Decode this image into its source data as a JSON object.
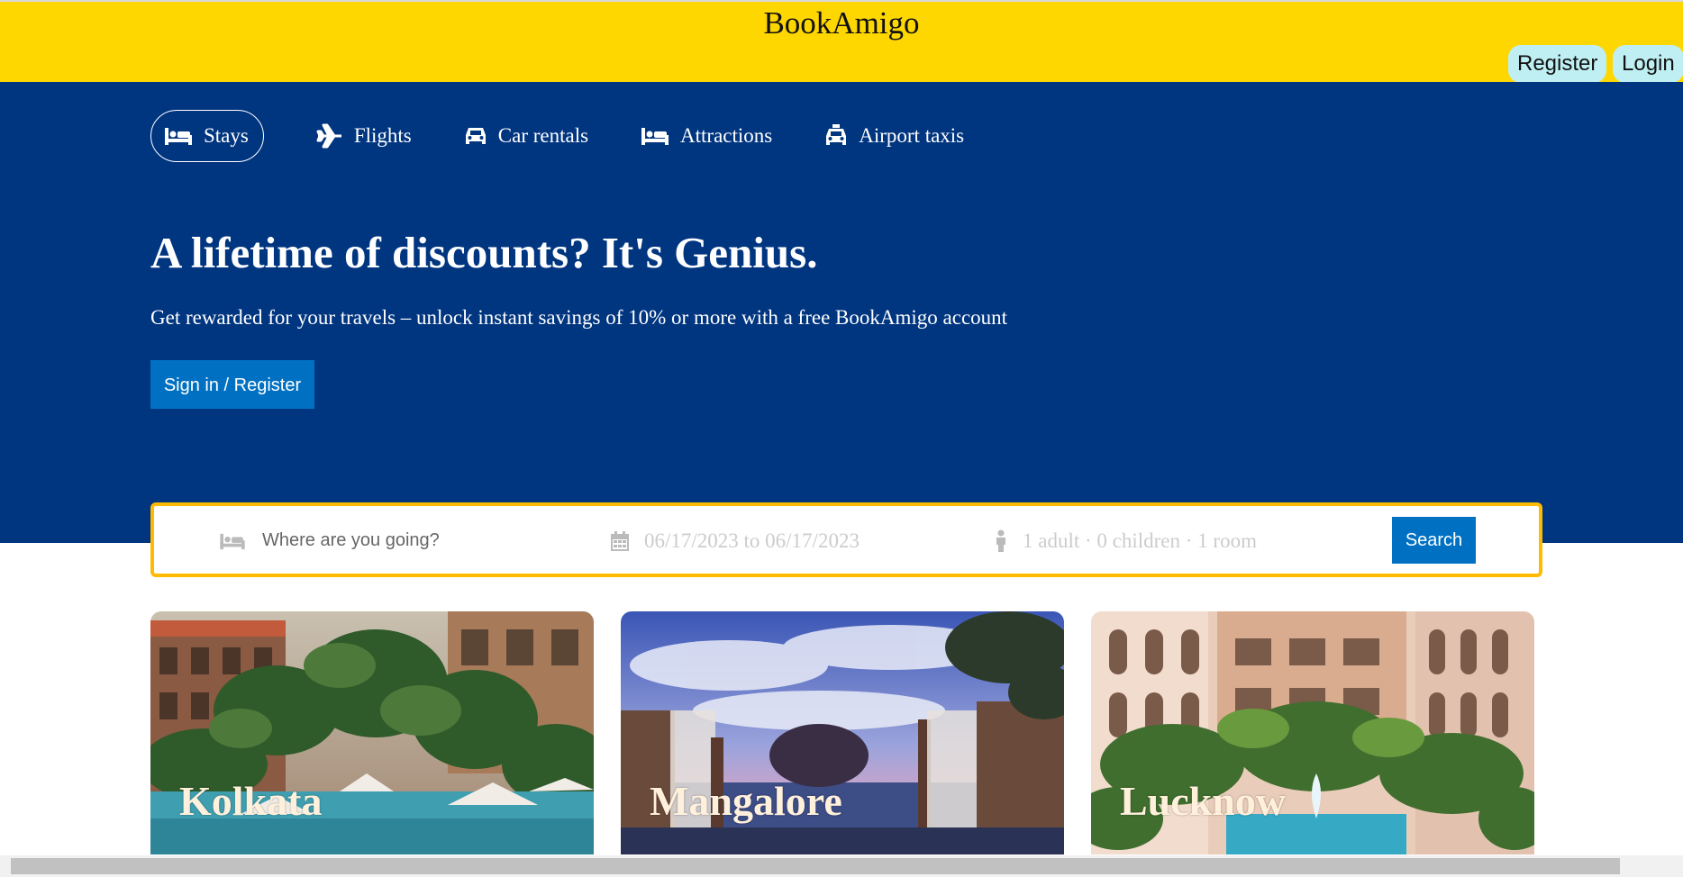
{
  "header": {
    "brand": "BookAmigo",
    "register_label": "Register",
    "login_label": "Login"
  },
  "nav": {
    "items": [
      {
        "label": "Stays",
        "icon": "bed-icon",
        "active": true
      },
      {
        "label": "Flights",
        "icon": "plane-icon",
        "active": false
      },
      {
        "label": "Car rentals",
        "icon": "car-icon",
        "active": false
      },
      {
        "label": "Attractions",
        "icon": "bed-icon",
        "active": false
      },
      {
        "label": "Airport taxis",
        "icon": "taxi-icon",
        "active": false
      }
    ]
  },
  "hero": {
    "headline": "A lifetime of discounts? It's Genius.",
    "subline": "Get rewarded for your travels – unlock instant savings of 10% or more with a free BookAmigo account",
    "signin_label": "Sign in / Register"
  },
  "search": {
    "destination_placeholder": "Where are you going?",
    "dates": "06/17/2023 to 06/17/2023",
    "guests": "1 adult · 0 children · 1 room",
    "button_label": "Search"
  },
  "cards": [
    {
      "city": "Kolkata"
    },
    {
      "city": "Mangalore"
    },
    {
      "city": "Lucknow"
    }
  ],
  "colors": {
    "topbar": "#ffd700",
    "hero": "#003580",
    "primary_button": "#0071c2",
    "search_border": "#febb02",
    "auth_button": "#bfeff2"
  }
}
